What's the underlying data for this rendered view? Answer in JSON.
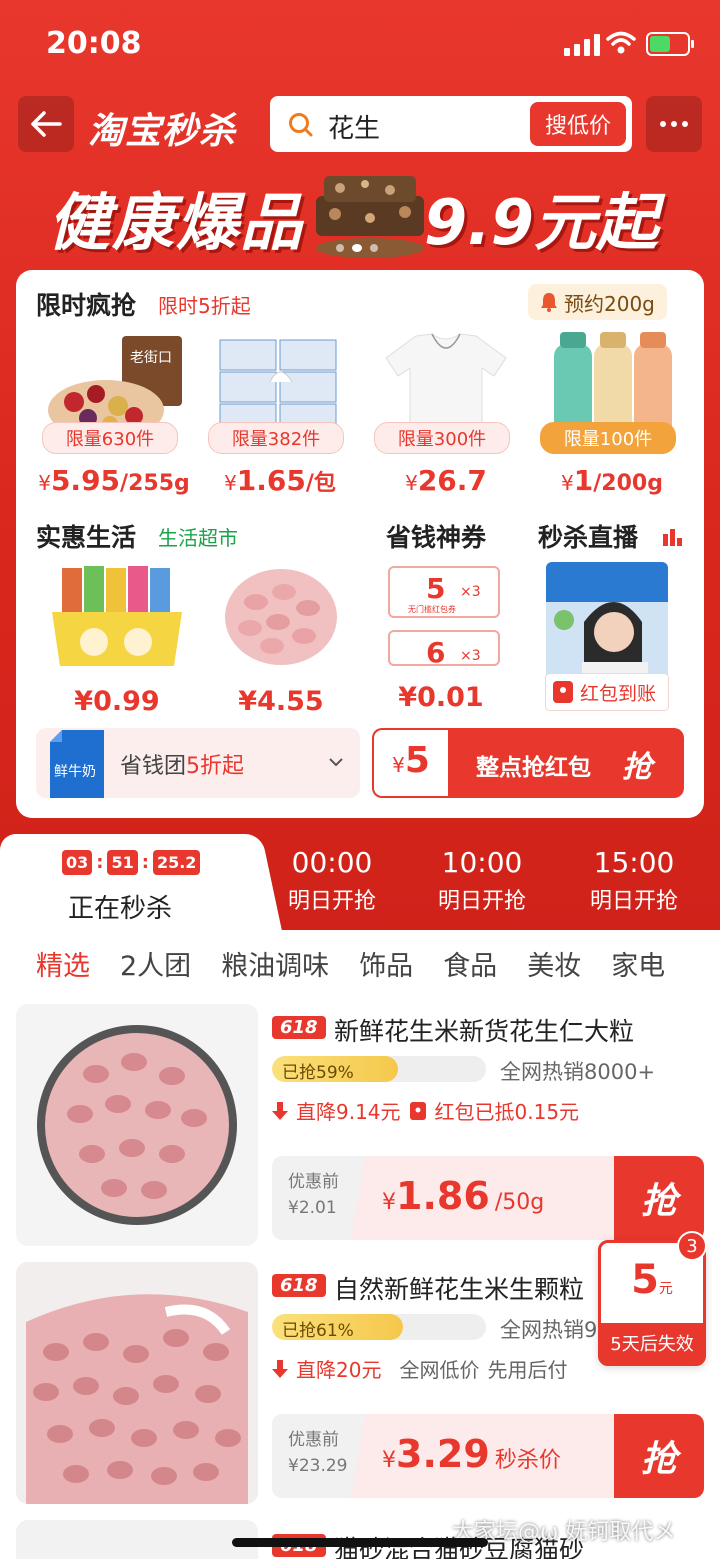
{
  "status": {
    "time": "20:08"
  },
  "nav": {
    "logo": "淘宝秒杀",
    "search_value": "花生",
    "search_button": "搜低价"
  },
  "banner": {
    "text1": "健康爆品",
    "text2": "9.9元起"
  },
  "flash": {
    "title": "限时疯抢",
    "subtitle": "限时5折起",
    "reserve": "预约200g",
    "products": [
      {
        "quota": "限量630件",
        "price": "5.95",
        "unit": "/255g"
      },
      {
        "quota": "限量382件",
        "price": "1.65",
        "unit": "/包"
      },
      {
        "quota": "限量300件",
        "price": "26.7",
        "unit": ""
      },
      {
        "quota": "限量100件",
        "price": "1",
        "unit": "/200g"
      }
    ]
  },
  "life": {
    "title": "实惠生活",
    "subtitle": "生活超市",
    "items": [
      {
        "price": "0.99"
      },
      {
        "price": "4.55"
      }
    ]
  },
  "coupons": {
    "title": "省钱神券",
    "c1": "5",
    "c2": "6",
    "x": "×3",
    "label": "无门槛红包券",
    "price": "0.01"
  },
  "live": {
    "title": "秒杀直播",
    "redpack": "红包到账"
  },
  "group": {
    "milk": "鲜牛奶",
    "label_pre": "省钱团",
    "label_hl": "5折起"
  },
  "hongbao": {
    "currency": "¥",
    "amount": "5",
    "text": "整点抢红包",
    "grab": "抢"
  },
  "currency": "¥",
  "sessions": {
    "countdown": [
      "03",
      "51",
      "25.2"
    ],
    "active_label": "正在秒杀",
    "others": [
      {
        "time": "00:00",
        "status": "明日开抢"
      },
      {
        "time": "10:00",
        "status": "明日开抢"
      },
      {
        "time": "15:00",
        "status": "明日开抢"
      }
    ]
  },
  "categories": [
    "精选",
    "2人团",
    "粮油调味",
    "饰品",
    "食品",
    "美妆",
    "家电"
  ],
  "items": [
    {
      "tag": "618",
      "title": "新鲜花生米新货花生仁大粒",
      "sold_pct": 59,
      "sold_text": "已抢59%",
      "hot": "全网热销8000+",
      "promo1": "直降9.14元",
      "promo2": "红包已抵0.15元",
      "orig_label": "优惠前",
      "orig_price": "¥2.01",
      "price": "1.86",
      "unit": "/50g",
      "grab": "抢"
    },
    {
      "tag": "618",
      "title": "自然新鲜花生米生颗粒",
      "sold_pct": 61,
      "sold_text": "已抢61%",
      "hot": "全网热销9",
      "promo1": "直降20元",
      "promo2": "全网低价",
      "promo3": "先用后付",
      "orig_label": "优惠前",
      "orig_price": "¥23.29",
      "price": "3.29",
      "unit": "秒杀价",
      "grab": "抢"
    }
  ],
  "float_coupon": {
    "badge": "3",
    "value": "5",
    "unit": "元",
    "expire": "5天后失效"
  },
  "peek_item": {
    "tag": "618",
    "title": "猫砂混合猫砂豆腐猫砂"
  },
  "watermark": "大家坛@ω 妩钶取代メ"
}
